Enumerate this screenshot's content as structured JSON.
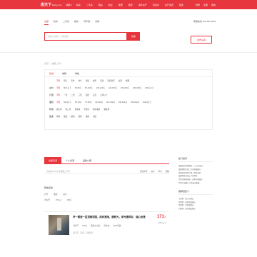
{
  "header": {
    "logo": "房天下",
    "logo_tag": "Fang.com",
    "city": "成都 ▾",
    "nav": [
      "新房",
      "二手房",
      "租房",
      "商业",
      "家居",
      "装修",
      "海外房产",
      "查房价",
      "房产资讯",
      "更多"
    ],
    "right": [
      "登录",
      "注册",
      "我的"
    ]
  },
  "search": {
    "tabs": [
      "全部",
      "新房",
      "二手房",
      "租房",
      "写字楼",
      "商铺"
    ],
    "active_tab": 0,
    "placeholder": "请输入小区名、学校名称...",
    "button": "搜索",
    "phone": "客服热线 400-890-0000",
    "post_button": "发布房源"
  },
  "breadcrumb": "房天下 > 成都二手房",
  "filters": {
    "tabs": [
      "区域",
      "地铁",
      "学校"
    ],
    "rows": [
      {
        "label": "",
        "options": [
          "不限",
          "锦江",
          "青羊",
          "金牛",
          "武侯",
          "成华",
          "高新",
          "天府新区",
          "双流",
          "郫都"
        ]
      },
      {
        "label": "总价",
        "options": [
          "不限",
          "50万以下",
          "50-80万",
          "80-100万",
          "100-120万",
          "120-150万",
          "150-200万",
          "200-300万",
          "300万以上"
        ]
      },
      {
        "label": "户型",
        "options": [
          "不限",
          "一居",
          "二居",
          "三居",
          "四居",
          "五居",
          "五居以上"
        ]
      },
      {
        "label": "面积",
        "options": [
          "不限",
          "50㎡以下",
          "50-70㎡",
          "70-90㎡",
          "90-110㎡",
          "110-130㎡",
          "130-150㎡",
          "150-200㎡",
          "200㎡以上"
        ]
      },
      {
        "label": "特色",
        "options": [
          "满五年",
          "满二年",
          "近地铁",
          "学区房",
          "随时看房",
          "精装修"
        ]
      },
      {
        "label": "更多",
        "options": [
          "朝向",
          "楼层",
          "楼龄",
          "装修",
          "电梯",
          "用途"
        ]
      }
    ]
  },
  "result_tabs": [
    "全部房源",
    "个人房源",
    "品牌公寓"
  ],
  "sort": {
    "summary": "共找到 85,210 套成都二手房",
    "options": [
      "默认排序",
      "总价",
      "单价",
      "面积"
    ]
  },
  "recommend": {
    "title": "猜你喜欢",
    "rows": [
      [
        "户型",
        "面积",
        "总价"
      ],
      [
        "3室2厅",
        "97.5㎡",
        "150万"
      ]
    ]
  },
  "listing": {
    "title": "环一期送一层顶楼花园，房间宽阔，面积大，采光通风好，诚心出售",
    "meta": [
      "4室2厅",
      "135㎡",
      "低层(共6层)",
      "南北向",
      "2010年建"
    ],
    "address": "锦江区 - 东湖 - 东湖名居",
    "price": "171",
    "price_unit": "万",
    "unit_price": "12666元/㎡"
  },
  "sidebar": {
    "title": "热门资讯",
    "items": [
      "成都楼市新政解读：二手房交易...",
      "成都哪些区域二手房涨幅最大...",
      "首套房贷利率下调，购房成本...",
      "成都地铁沿线二手房推荐...",
      "学区房选购指南，这些坑要避开...",
      "2024年成都二手房成交数据..."
    ],
    "title2": "推荐经纪人",
    "items2": [
      "王经理 · 锦江东湖店",
      "李经理 · 高新金融城店",
      "张经理 · 武侯双楠店",
      "刘经理 · 成华建设路店"
    ]
  },
  "colors": {
    "accent": "#e8363e"
  }
}
